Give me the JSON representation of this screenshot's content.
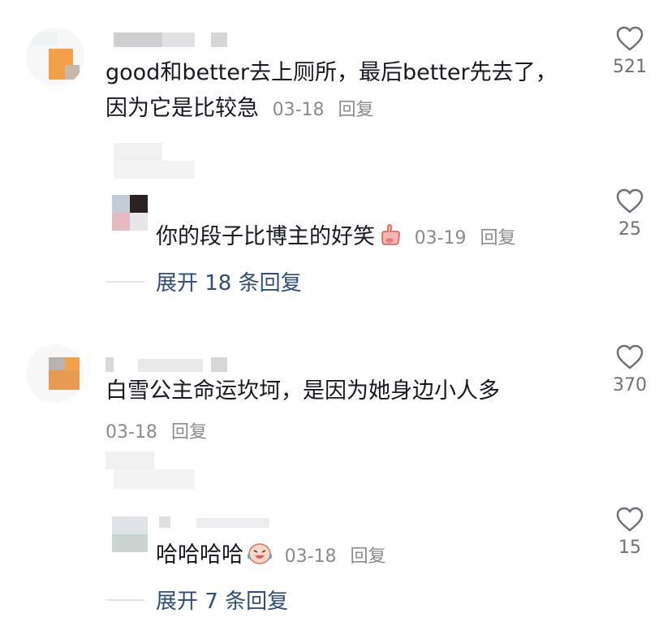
{
  "comments": [
    {
      "text_line1": "good和better去上厕所，最后better先去了，",
      "text_line2": "因为它是比较急",
      "date": "03-18",
      "reply_label": "回复",
      "likes": "521",
      "reply": {
        "text": "你的段子比博主的好笑",
        "emoji": "thumbs-up-emoji",
        "date": "03-19",
        "reply_label": "回复",
        "likes": "25"
      },
      "expand_label": "展开 18 条回复"
    },
    {
      "text_line1": "白雪公主命运坎坷，是因为她身边小人多",
      "date": "03-18",
      "reply_label": "回复",
      "likes": "370",
      "reply": {
        "text": "哈哈哈哈",
        "emoji": "laughing-crying-emoji",
        "date": "03-18",
        "reply_label": "回复",
        "likes": "15"
      },
      "expand_label": "展开 7 条回复"
    }
  ],
  "colors": {
    "text": "#161823",
    "meta": "#8a8b91",
    "expand": "#2f4e7c",
    "avatar_orange": "#f2a14a"
  }
}
